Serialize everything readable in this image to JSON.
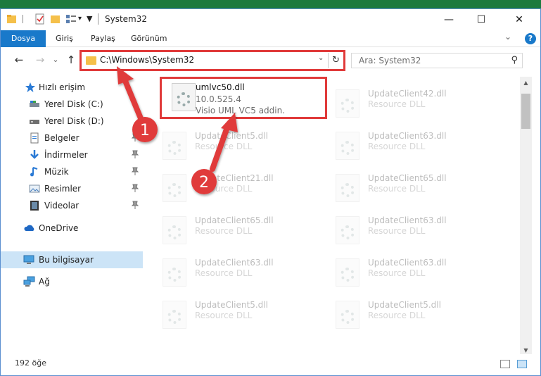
{
  "window": {
    "title": "System32",
    "controls": {
      "minimize": "—",
      "maximize": "☐",
      "close": "✕"
    }
  },
  "ribbon": {
    "tabs": [
      "Dosya",
      "Giriş",
      "Paylaş",
      "Görünüm"
    ],
    "expand_icon": "chevron-down-icon",
    "help": "?"
  },
  "nav": {
    "back": "←",
    "forward": "→",
    "recent": "⌄",
    "up": "↑",
    "address_path": "C:\\Windows\\System32",
    "address_dropdown": "⌄",
    "refresh": "↻",
    "search_placeholder": "Ara: System32",
    "search_icon": "⚲"
  },
  "sidebar": {
    "items": [
      {
        "label": "Hızlı erişim",
        "icon": "star-icon",
        "pinned": false
      },
      {
        "label": "Yerel Disk (C:)",
        "icon": "drive-icon",
        "pinned": false
      },
      {
        "label": "Yerel Disk (D:)",
        "icon": "drive-icon",
        "pinned": false
      },
      {
        "label": "Belgeler",
        "icon": "documents-icon",
        "pinned": true
      },
      {
        "label": "İndirmeler",
        "icon": "download-icon",
        "pinned": true
      },
      {
        "label": "Müzik",
        "icon": "music-icon",
        "pinned": true
      },
      {
        "label": "Resimler",
        "icon": "pictures-icon",
        "pinned": true
      },
      {
        "label": "Videolar",
        "icon": "video-icon",
        "pinned": true
      },
      {
        "label": "OneDrive",
        "icon": "cloud-icon",
        "pinned": false
      },
      {
        "label": "Bu bilgisayar",
        "icon": "computer-icon",
        "pinned": false,
        "selected": true
      },
      {
        "label": "Ağ",
        "icon": "network-icon",
        "pinned": false
      }
    ],
    "pin_glyph": "📌"
  },
  "files": {
    "left": [
      {
        "name": "umlvc50.dll",
        "version": "10.0.525.4",
        "desc": "Visio UML VC5 addin.",
        "highlighted": true
      },
      {
        "name": "UpdateClient5.dll",
        "version": "Resource DLL",
        "desc": ""
      },
      {
        "name": "UpdateClient21.dll",
        "version": "Resource DLL",
        "desc": ""
      },
      {
        "name": "UpdateClient65.dll",
        "version": "Resource DLL",
        "desc": ""
      },
      {
        "name": "UpdateClient63.dll",
        "version": "Resource DLL",
        "desc": ""
      },
      {
        "name": "UpdateClient5.dll",
        "version": "Resource DLL",
        "desc": ""
      }
    ],
    "right": [
      {
        "name": "UpdateClient42.dll",
        "version": "Resource DLL",
        "desc": ""
      },
      {
        "name": "UpdateClient63.dll",
        "version": "Resource DLL",
        "desc": ""
      },
      {
        "name": "UpdateClient65.dll",
        "version": "Resource DLL",
        "desc": ""
      },
      {
        "name": "UpdateClient63.dll",
        "version": "Resource DLL",
        "desc": ""
      },
      {
        "name": "UpdateClient63.dll",
        "version": "Resource DLL",
        "desc": ""
      },
      {
        "name": "UpdateClient5.dll",
        "version": "Resource DLL",
        "desc": ""
      }
    ]
  },
  "annotations": {
    "step1": "1",
    "step2": "2",
    "color": "#e03a3a"
  },
  "status": {
    "item_count": "192 öğe"
  },
  "colors": {
    "accent": "#1979ca",
    "selection": "#cce4f7",
    "highlight_border": "#e03a3a"
  }
}
